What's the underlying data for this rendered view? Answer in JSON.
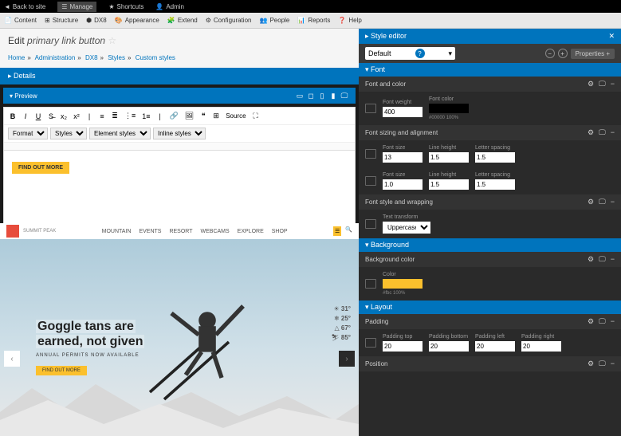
{
  "topbar": {
    "back": "Back to site",
    "manage": "Manage",
    "shortcuts": "Shortcuts",
    "admin": "Admin"
  },
  "toolbar": {
    "content": "Content",
    "structure": "Structure",
    "dx8": "DX8",
    "appearance": "Appearance",
    "extend": "Extend",
    "configuration": "Configuration",
    "people": "People",
    "reports": "Reports",
    "help": "Help"
  },
  "edit": {
    "prefix": "Edit",
    "title": "primary link button"
  },
  "breadcrumb": {
    "home": "Home",
    "admin": "Administration",
    "dx8": "DX8",
    "styles": "Styles",
    "custom": "Custom styles"
  },
  "details": "Details",
  "preview": {
    "label": "Preview",
    "button": "FIND OUT MORE"
  },
  "editor_dropdowns": {
    "format": "Format",
    "styles": "Styles",
    "elements": "Element styles",
    "inline": "Inline styles"
  },
  "site": {
    "nav": [
      "MOUNTAIN",
      "EVENTS",
      "RESORT",
      "WEBCAMS",
      "EXPLORE",
      "SHOP"
    ],
    "hero_line1": "Goggle tans are",
    "hero_line2": "earned, not given",
    "hero_sub": "ANNUAL PERMITS NOW AVAILABLE",
    "hero_btn": "FIND OUT MORE",
    "weather": [
      {
        "t": "31°"
      },
      {
        "t": "25°"
      },
      {
        "t": "67°"
      },
      {
        "t": "85°"
      }
    ]
  },
  "style_editor": {
    "title": "Style editor",
    "default": "Default",
    "properties": "Properties",
    "sections": {
      "font": "Font",
      "font_color": "Font and color",
      "font_sizing": "Font sizing and alignment",
      "font_style": "Font style and wrapping",
      "background": "Background",
      "bg_color": "Background color",
      "layout": "Layout",
      "padding": "Padding",
      "position": "Position"
    },
    "labels": {
      "font_weight": "Font weight",
      "font_color_l": "Font color",
      "font_size": "Font size",
      "line_height": "Line height",
      "letter_spacing": "Letter spacing",
      "text_transform": "Text transform",
      "color": "Color",
      "padding_top": "Padding top",
      "padding_bottom": "Padding bottom",
      "padding_left": "Padding left",
      "padding_right": "Padding right"
    },
    "values": {
      "font_weight": "400",
      "hex_black": "#00000 100%",
      "fs1": "13",
      "lh1": "1.5",
      "ls1": "1.5",
      "fs2": "1.0",
      "lh2": "1.5",
      "ls2": "1.5",
      "transform": "Uppercase",
      "hex_yellow": "#fbc 100%",
      "pt": "20",
      "pb": "20",
      "pl": "20",
      "pr": "20"
    }
  }
}
